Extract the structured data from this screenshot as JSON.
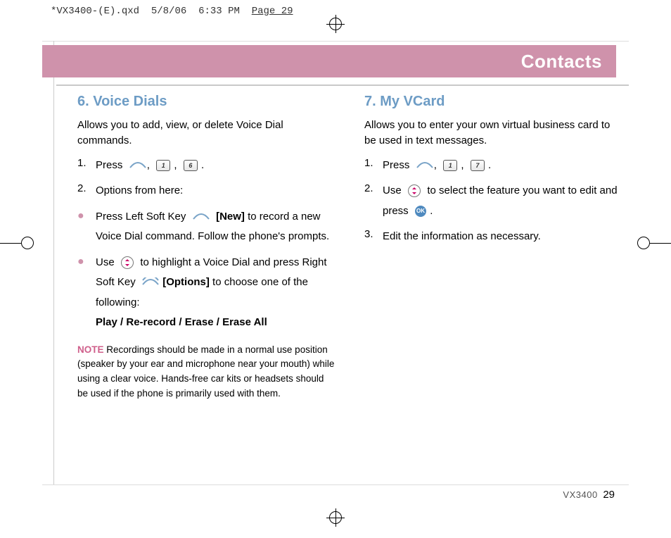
{
  "slug": {
    "file": "*VX3400-(E).qxd",
    "date": "5/8/06",
    "time": "6:33 PM",
    "pagelabel": "Page 29"
  },
  "header": {
    "title": "Contacts"
  },
  "left": {
    "heading": "6. Voice Dials",
    "intro": "Allows you to add, view, or delete Voice Dial commands.",
    "step1_prefix": "Press",
    "key1": "1",
    "key6": "6",
    "step2": "Options from here:",
    "bullet1_a": "Press Left Soft Key",
    "bullet1_new": "[New]",
    "bullet1_b": "to record a new Voice Dial command. Follow the phone's prompts.",
    "bullet2_a": "Use",
    "bullet2_b": "to highlight a Voice Dial and press Right Soft Key",
    "bullet2_options": "[Options]",
    "bullet2_c": "to choose one of the following:",
    "bullet2_list": "Play / Re-record / Erase / Erase All",
    "note_label": "NOTE",
    "note_body": "Recordings should be made in a normal use position (speaker by your ear and microphone near your mouth) while using a clear voice. Hands-free car kits or headsets should be used if the phone is primarily used with them."
  },
  "right": {
    "heading": "7. My VCard",
    "intro": "Allows you to enter your own virtual business card to be used in text messages.",
    "step1_prefix": "Press",
    "key1": "1",
    "key7": "7",
    "step2_a": "Use",
    "step2_b": "to select the feature you want to edit and press",
    "step3": "Edit the information as necessary."
  },
  "footer": {
    "model": "VX3400",
    "page": "29"
  },
  "icons": {
    "ok": "OK"
  }
}
